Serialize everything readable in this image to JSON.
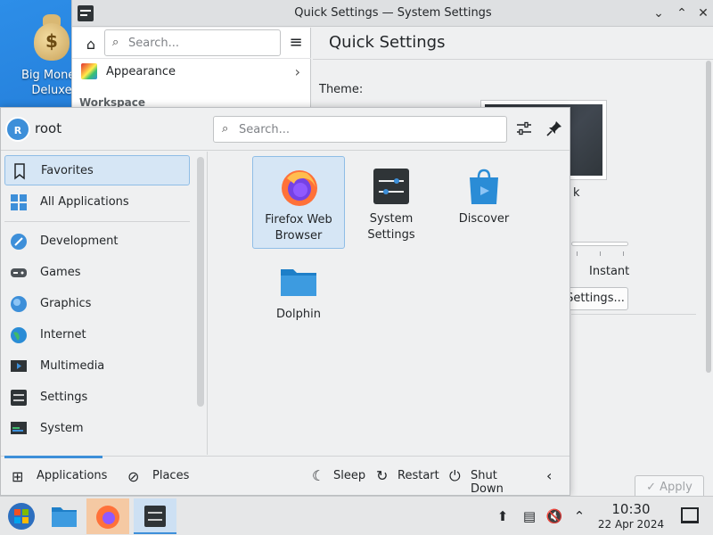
{
  "desktop": {
    "icon_label": "Big Money Deluxe"
  },
  "system_settings": {
    "window_title": "Quick Settings — System Settings",
    "search_placeholder": "Search...",
    "appearance_label": "Appearance",
    "workspace_label": "Workspace",
    "page_title": "Quick Settings",
    "theme_label": "Theme:",
    "theme_partial_label": "k",
    "animation_speed_label": "Instant",
    "settings_button": "Settings...",
    "apply_button": "Apply"
  },
  "launcher": {
    "user_name": "root",
    "user_initial": "R",
    "search_placeholder": "Search...",
    "categories": [
      {
        "label": "Favorites",
        "icon": "bookmark-icon",
        "selected": true
      },
      {
        "label": "All Applications",
        "icon": "grid-icon"
      },
      {
        "label": "Development",
        "icon": "development-icon"
      },
      {
        "label": "Games",
        "icon": "gamepad-icon"
      },
      {
        "label": "Graphics",
        "icon": "graphics-icon"
      },
      {
        "label": "Internet",
        "icon": "globe-icon"
      },
      {
        "label": "Multimedia",
        "icon": "multimedia-icon"
      },
      {
        "label": "Settings",
        "icon": "settings-icon"
      },
      {
        "label": "System",
        "icon": "system-icon"
      }
    ],
    "apps": [
      {
        "label": "Firefox Web Browser",
        "icon": "firefox-icon",
        "selected": true
      },
      {
        "label": "System Settings",
        "icon": "system-settings-icon"
      },
      {
        "label": "Discover",
        "icon": "discover-icon"
      },
      {
        "label": "Dolphin",
        "icon": "dolphin-folder-icon"
      }
    ],
    "footer": {
      "applications_tab": "Applications",
      "places_tab": "Places",
      "sleep": "Sleep",
      "restart": "Restart",
      "shut_down": "Shut Down"
    }
  },
  "taskbar": {
    "time": "10:30",
    "date": "22 Apr 2024"
  }
}
